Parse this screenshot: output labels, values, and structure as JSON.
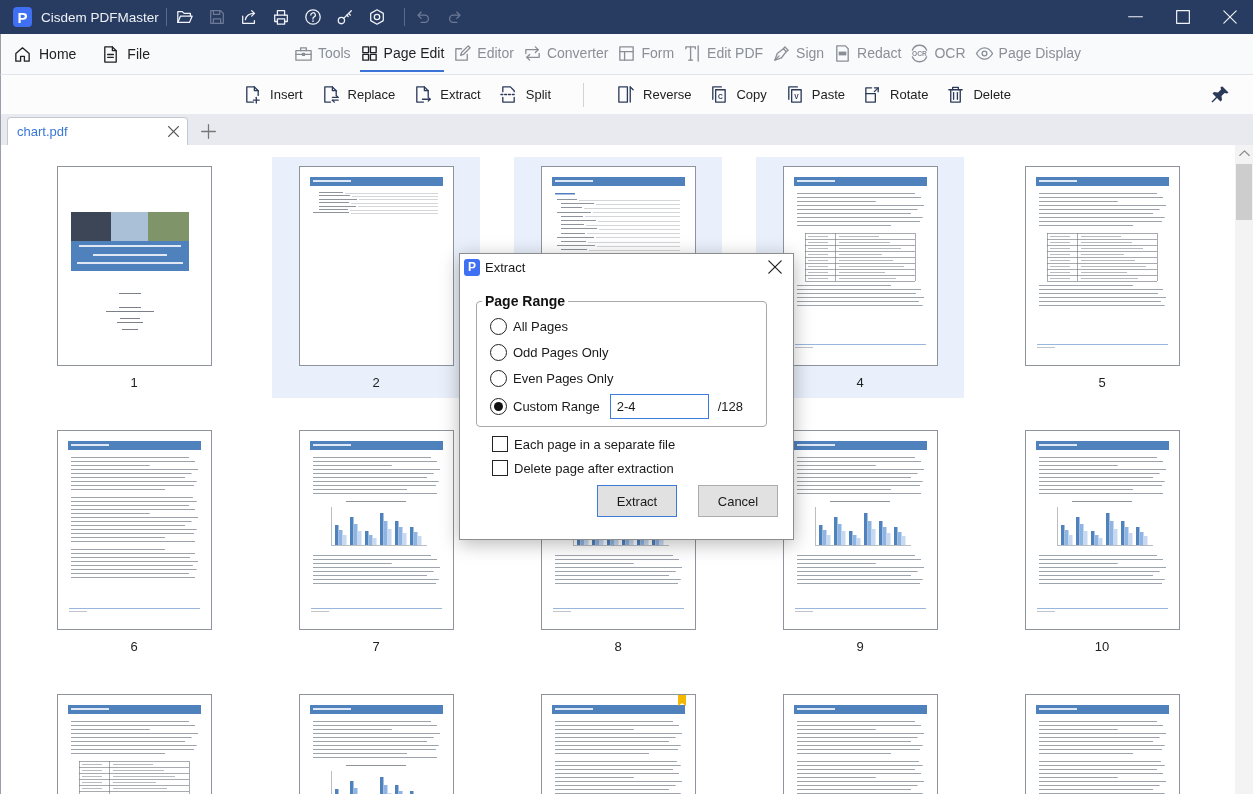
{
  "window": {
    "logo_letter": "P",
    "app_name": "Cisdem PDFMaster"
  },
  "quick_access": {
    "groups": [
      [
        {
          "kind": "open",
          "disabled": false
        },
        {
          "kind": "save",
          "disabled": true
        },
        {
          "kind": "share",
          "disabled": false
        },
        {
          "kind": "print",
          "disabled": false
        },
        {
          "kind": "help",
          "disabled": false
        },
        {
          "kind": "key",
          "disabled": false
        },
        {
          "kind": "settings",
          "disabled": false
        }
      ],
      [
        {
          "kind": "undo",
          "disabled": true
        },
        {
          "kind": "redo",
          "disabled": true
        }
      ]
    ]
  },
  "nav": {
    "left": [
      {
        "kind": "home",
        "label": "Home"
      },
      {
        "kind": "file",
        "label": "File"
      }
    ],
    "tabs": [
      {
        "kind": "tools",
        "label": "Tools",
        "selected": false
      },
      {
        "kind": "pages",
        "label": "Page Edit",
        "selected": true
      },
      {
        "kind": "editor",
        "label": "Editor",
        "selected": false
      },
      {
        "kind": "converter",
        "label": "Converter",
        "selected": false
      },
      {
        "kind": "form",
        "label": "Form",
        "selected": false
      },
      {
        "kind": "text",
        "label": "Edit PDF",
        "selected": false
      },
      {
        "kind": "sign",
        "label": "Sign",
        "selected": false
      },
      {
        "kind": "redact",
        "label": "Redact",
        "selected": false
      },
      {
        "kind": "ocr",
        "label": "OCR",
        "selected": false,
        "icon_text": "OCR"
      },
      {
        "kind": "display",
        "label": "Page Display",
        "selected": false
      }
    ]
  },
  "toolbar": {
    "groups": [
      [
        {
          "kind": "insert",
          "label": "Insert"
        },
        {
          "kind": "replace",
          "label": "Replace"
        },
        {
          "kind": "extract",
          "label": "Extract"
        },
        {
          "kind": "split",
          "label": "Split"
        }
      ],
      [
        {
          "kind": "reverse",
          "label": "Reverse"
        },
        {
          "kind": "copy",
          "label": "Copy",
          "icon_text": "C"
        },
        {
          "kind": "paste",
          "label": "Paste",
          "icon_text": "V"
        },
        {
          "kind": "rotate",
          "label": "Rotate"
        },
        {
          "kind": "delete",
          "label": "Delete"
        }
      ]
    ]
  },
  "document_tabs": [
    {
      "label": "chart.pdf",
      "selected": true
    }
  ],
  "pages": [
    {
      "kind": "cover",
      "label": "1",
      "selected": false,
      "bookmarked": false
    },
    {
      "kind": "list",
      "label": "2",
      "selected": true,
      "bookmarked": false
    },
    {
      "kind": "toc",
      "selected": true,
      "bookmarked": false
    },
    {
      "kind": "table",
      "label": "4",
      "selected": true,
      "bookmarked": false
    },
    {
      "kind": "table",
      "label": "5",
      "selected": false,
      "bookmarked": false
    },
    {
      "kind": "text",
      "label": "6",
      "selected": false,
      "bookmarked": false
    },
    {
      "kind": "figure",
      "label": "7",
      "selected": false,
      "bookmarked": false
    },
    {
      "kind": "figure",
      "label": "8",
      "selected": false,
      "bookmarked": false
    },
    {
      "kind": "figure",
      "label": "9",
      "selected": false,
      "bookmarked": false
    },
    {
      "kind": "figure",
      "label": "10",
      "selected": false,
      "bookmarked": false
    },
    {
      "kind": "table",
      "selected": false,
      "bookmarked": false
    },
    {
      "kind": "figure",
      "selected": false,
      "bookmarked": false
    },
    {
      "kind": "text",
      "selected": false,
      "bookmarked": true
    },
    {
      "kind": "text",
      "selected": false,
      "bookmarked": false
    },
    {
      "kind": "text",
      "selected": false,
      "bookmarked": false
    }
  ],
  "extract_dialog": {
    "logo_letter": "P",
    "title": "Extract",
    "group_title": "Page Range",
    "options": [
      {
        "kind": "preset",
        "label": "All Pages",
        "selected": false
      },
      {
        "kind": "preset",
        "label": "Odd Pages Only",
        "selected": false
      },
      {
        "kind": "preset",
        "label": "Even Pages Only",
        "selected": false
      },
      {
        "kind": "custom",
        "label": "Custom Range",
        "selected": true,
        "value": "2-4",
        "total": "/128"
      }
    ],
    "checkboxes": [
      {
        "label": "Each page in a separate file",
        "checked": false
      },
      {
        "label": "Delete page after extraction",
        "checked": false
      }
    ],
    "buttons": [
      {
        "kind": "primary",
        "label": "Extract"
      },
      {
        "kind": "secondary",
        "label": "Cancel"
      }
    ]
  }
}
